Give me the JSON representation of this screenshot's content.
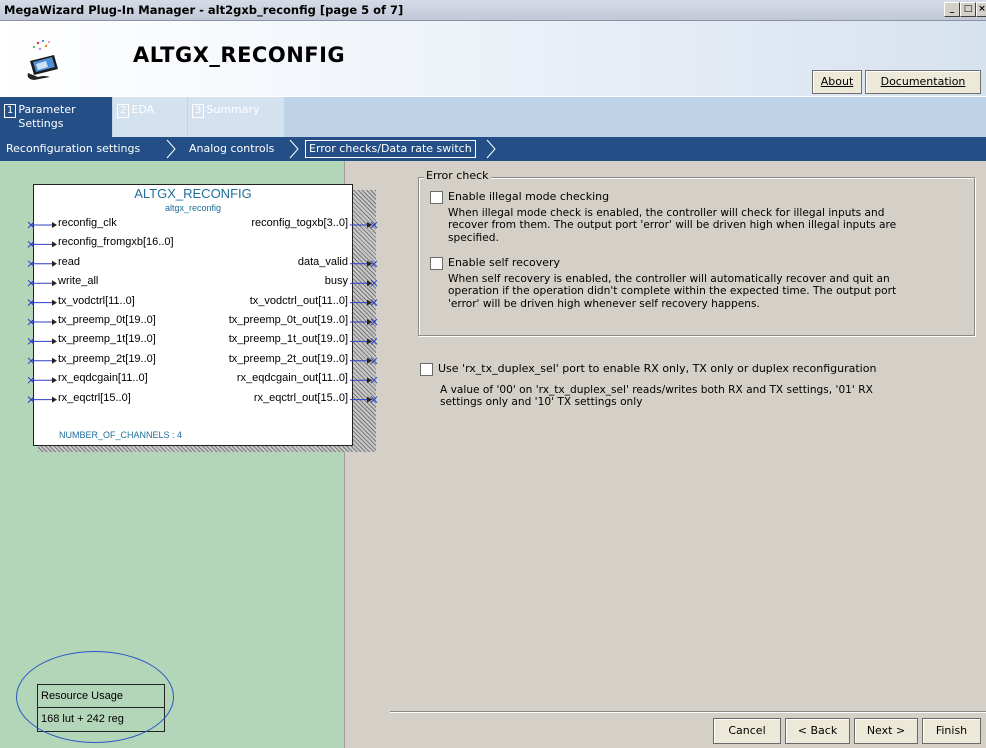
{
  "window": {
    "title": "MegaWizard Plug-In Manager - alt2gxb_reconfig [page 5 of 7]"
  },
  "header": {
    "title": "ALTGX_RECONFIG",
    "about_label": "About",
    "documentation_label": "Documentation"
  },
  "tabs": [
    {
      "num": "1",
      "label": "Parameter Settings",
      "active": true
    },
    {
      "num": "2",
      "label": "EDA",
      "active": false
    },
    {
      "num": "3",
      "label": "Summary",
      "active": false
    }
  ],
  "breadcrumb": [
    "Reconfiguration settings",
    "Analog controls",
    "Error checks/Data rate switch"
  ],
  "block": {
    "title": "ALTGX_RECONFIG",
    "subtitle": "altgx_reconfig",
    "inputs": [
      "reconfig_clk",
      "reconfig_fromgxb[16..0]",
      "read",
      "write_all",
      "tx_vodctrl[11..0]",
      "tx_preemp_0t[19..0]",
      "tx_preemp_1t[19..0]",
      "tx_preemp_2t[19..0]",
      "rx_eqdcgain[11..0]",
      "rx_eqctrl[15..0]"
    ],
    "outputs": [
      "reconfig_togxb[3..0]",
      "",
      "data_valid",
      "busy",
      "tx_vodctrl_out[11..0]",
      "tx_preemp_0t_out[19..0]",
      "tx_preemp_1t_out[19..0]",
      "tx_preemp_2t_out[19..0]",
      "rx_eqdcgain_out[11..0]",
      "rx_eqctrl_out[15..0]"
    ],
    "channels": "NUMBER_OF_CHANNELS : 4"
  },
  "resource_usage": {
    "label": "Resource Usage",
    "value": "168 lut + 242 reg"
  },
  "error_check": {
    "legend": "Error check",
    "illegal_mode_label": "Enable illegal mode checking",
    "illegal_mode_desc": "When illegal mode check is enabled, the controller will check for illegal inputs and recover from them. The output port 'error' will be driven high when illegal inputs are specified.",
    "illegal_mode_checked": false,
    "self_recovery_label": "Enable self recovery",
    "self_recovery_desc": "When self recovery is enabled, the controller will automatically recover and quit an operation if the operation didn't complete within the expected time. The output port 'error' will be driven high whenever self recovery happens.",
    "self_recovery_checked": false
  },
  "duplex": {
    "label": "Use 'rx_tx_duplex_sel' port to enable RX only, TX only or duplex reconfiguration",
    "desc": "A value of '00' on 'rx_tx_duplex_sel' reads/writes both RX and TX settings, '01' RX settings only and '10' TX settings only",
    "checked": false
  },
  "buttons": {
    "cancel": "Cancel",
    "back": "< Back",
    "next": "Next >",
    "finish": "Finish"
  },
  "colors": {
    "tab_bar": "#bfd3e8",
    "breadcrumb_bar": "#244f86",
    "left_pane": "#b3d6b8",
    "right_pane": "#d4d0c8",
    "block_text": "#1f6f9a",
    "pin_arrow": "#2a3fc8"
  }
}
